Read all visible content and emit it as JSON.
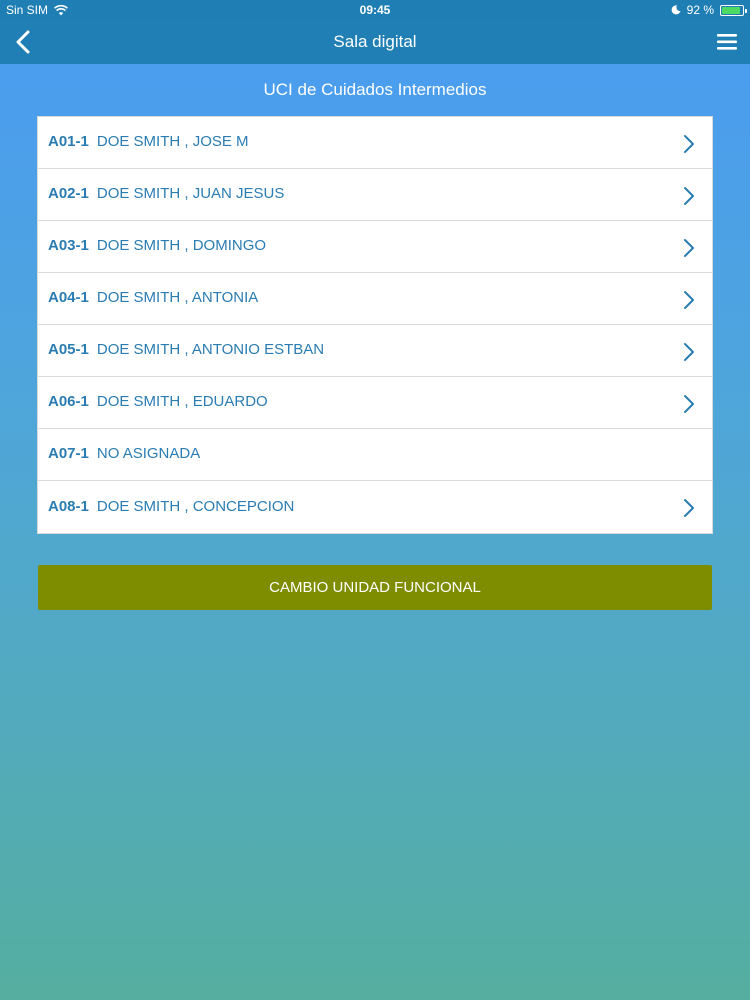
{
  "status_bar": {
    "carrier": "Sin SIM",
    "time": "09:45",
    "battery": "92 %",
    "battery_level": 0.92,
    "icons": [
      "wifi-icon",
      "moon-icon",
      "battery-icon"
    ]
  },
  "navbar": {
    "title": "Sala digital",
    "back_icon": "chevron-left-icon",
    "menu_icon": "hamburger-menu-icon"
  },
  "unit": {
    "title": "UCI de Cuidados Intermedios"
  },
  "beds": [
    {
      "code": "A01-1",
      "patient": "DOE SMITH , JOSE M",
      "has_chevron": true
    },
    {
      "code": "A02-1",
      "patient": "DOE SMITH , JUAN JESUS",
      "has_chevron": true
    },
    {
      "code": "A03-1",
      "patient": "DOE SMITH , DOMINGO",
      "has_chevron": true
    },
    {
      "code": "A04-1",
      "patient": "DOE SMITH , ANTONIA",
      "has_chevron": true
    },
    {
      "code": "A05-1",
      "patient": "DOE SMITH , ANTONIO ESTBAN",
      "has_chevron": true
    },
    {
      "code": "A06-1",
      "patient": "DOE SMITH , EDUARDO",
      "has_chevron": true
    },
    {
      "code": "A07-1",
      "patient": "NO ASIGNADA",
      "has_chevron": false
    },
    {
      "code": "A08-1",
      "patient": "DOE SMITH , CONCEPCION",
      "has_chevron": true
    }
  ],
  "action_button": {
    "label": "CAMBIO UNIDAD FUNCIONAL"
  },
  "colors": {
    "header": "#207fb5",
    "text_accent": "#2a7cb2",
    "button": "#7e8d00",
    "battery_fill": "#4cd964"
  }
}
